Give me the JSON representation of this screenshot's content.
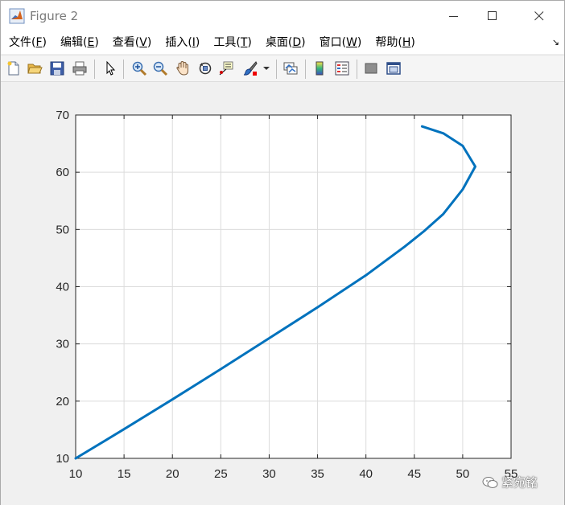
{
  "window": {
    "title": "Figure 2",
    "icon": "matlab-icon"
  },
  "menu": [
    {
      "label": "文件",
      "key": "F"
    },
    {
      "label": "编辑",
      "key": "E"
    },
    {
      "label": "查看",
      "key": "V"
    },
    {
      "label": "插入",
      "key": "I"
    },
    {
      "label": "工具",
      "key": "T"
    },
    {
      "label": "桌面",
      "key": "D"
    },
    {
      "label": "窗口",
      "key": "W"
    },
    {
      "label": "帮助",
      "key": "H"
    }
  ],
  "toolbar": {
    "icons": [
      "new-figure-icon",
      "open-file-icon",
      "save-icon",
      "print-icon",
      "edit-plot-icon",
      "zoom-in-icon",
      "zoom-out-icon",
      "pan-icon",
      "rotate-3d-icon",
      "data-cursor-icon",
      "brush-icon",
      "link-plot-icon",
      "colorbar-icon",
      "legend-icon",
      "hide-plot-tools-icon",
      "show-plot-tools-icon"
    ]
  },
  "colors": {
    "line": "#0072BD",
    "grid": "#dcdcdc",
    "axes_bg": "#ffffff"
  },
  "watermark": {
    "text": "紧宛铭",
    "icon": "wechat-icon"
  },
  "chart_data": {
    "type": "line",
    "xlim": [
      10,
      55
    ],
    "ylim": [
      10,
      70
    ],
    "xticks": [
      10,
      15,
      20,
      25,
      30,
      35,
      40,
      45,
      50,
      55
    ],
    "yticks": [
      10,
      20,
      30,
      40,
      50,
      60,
      70
    ],
    "grid": true,
    "series": [
      {
        "x": [
          10,
          15,
          20,
          25,
          30,
          35,
          40,
          44,
          46,
          48,
          50,
          51.3,
          50,
          48,
          45.8
        ],
        "y": [
          10,
          15.1,
          20.3,
          25.6,
          31,
          36.4,
          42,
          47,
          49.7,
          52.7,
          57,
          61,
          64.6,
          66.8,
          68
        ]
      }
    ]
  }
}
